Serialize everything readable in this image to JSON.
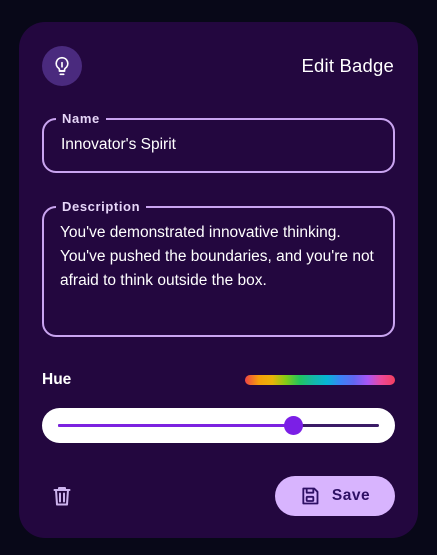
{
  "header": {
    "title": "Edit Badge",
    "icon": "lightbulb-icon"
  },
  "form": {
    "name": {
      "label": "Name",
      "value": "Innovator's Spirit"
    },
    "description": {
      "label": "Description",
      "value": "You've demonstrated innovative thinking. You've pushed the boundaries, and you're not afraid to think outside the box."
    },
    "hue": {
      "label": "Hue",
      "value_fraction": 0.735
    }
  },
  "actions": {
    "delete_icon": "trash-icon",
    "save_label": "Save",
    "save_icon": "floppy-disk-icon"
  },
  "colors": {
    "background": "#080818",
    "card": "#23073f",
    "accent": "#7b1fe6",
    "field_border": "#c9a4f0",
    "save_button": "#d8b4fe"
  }
}
